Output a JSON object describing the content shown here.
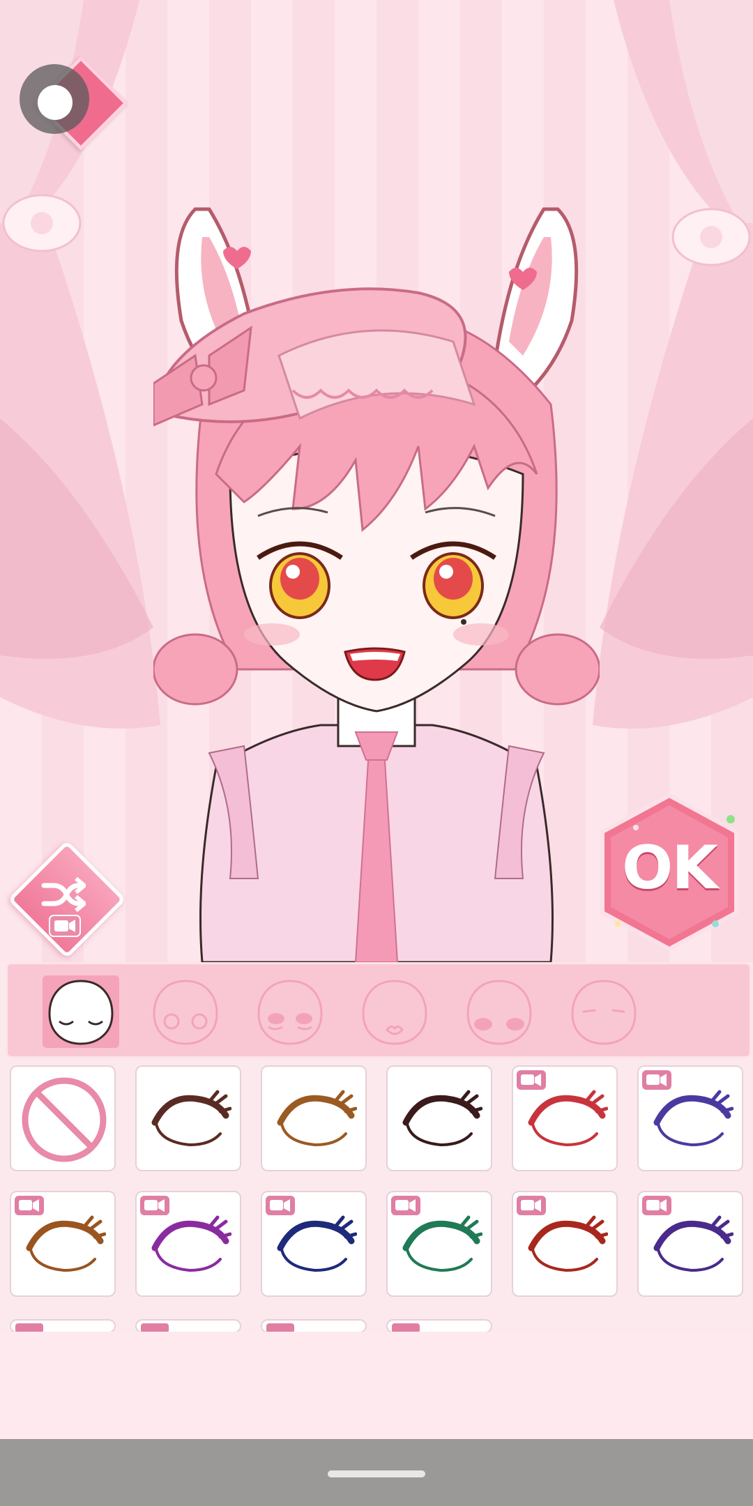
{
  "screen": "face-editor",
  "top_toggle": {
    "icon": "toggle-icon"
  },
  "random_button": {
    "icon": "shuffle-icon",
    "badge_icon": "video-ad-icon"
  },
  "ok_button": {
    "label": "OK"
  },
  "face_tabs": [
    {
      "icon": "face-closed-eyes-icon",
      "selected": true
    },
    {
      "icon": "face-open-eyes-icon",
      "selected": false
    },
    {
      "icon": "face-blush-closed-eyes-icon",
      "selected": false
    },
    {
      "icon": "face-mouth-icon",
      "selected": false
    },
    {
      "icon": "face-cheeks-icon",
      "selected": false
    },
    {
      "icon": "face-brow-icon",
      "selected": false
    }
  ],
  "items": [
    {
      "icon": "none-icon",
      "locked_video": false
    },
    {
      "color": "#5a2b24",
      "locked_video": false
    },
    {
      "color": "#9a5a22",
      "locked_video": false
    },
    {
      "color": "#3a1a1c",
      "locked_video": false
    },
    {
      "color": "#c8343b",
      "locked_video": true
    },
    {
      "color": "#4a3aa0",
      "locked_video": true
    },
    {
      "color": "#9a5420",
      "locked_video": true
    },
    {
      "color": "#8a2aa0",
      "locked_video": true
    },
    {
      "color": "#1e2a7a",
      "locked_video": true
    },
    {
      "color": "#1f7a55",
      "locked_video": true
    },
    {
      "color": "#a8281e",
      "locked_video": true
    },
    {
      "color": "#4a2a8a",
      "locked_video": true
    }
  ],
  "colors": {
    "accent": "#f06c8f",
    "panel": "#f9c7d4",
    "background": "#fde9ee"
  }
}
